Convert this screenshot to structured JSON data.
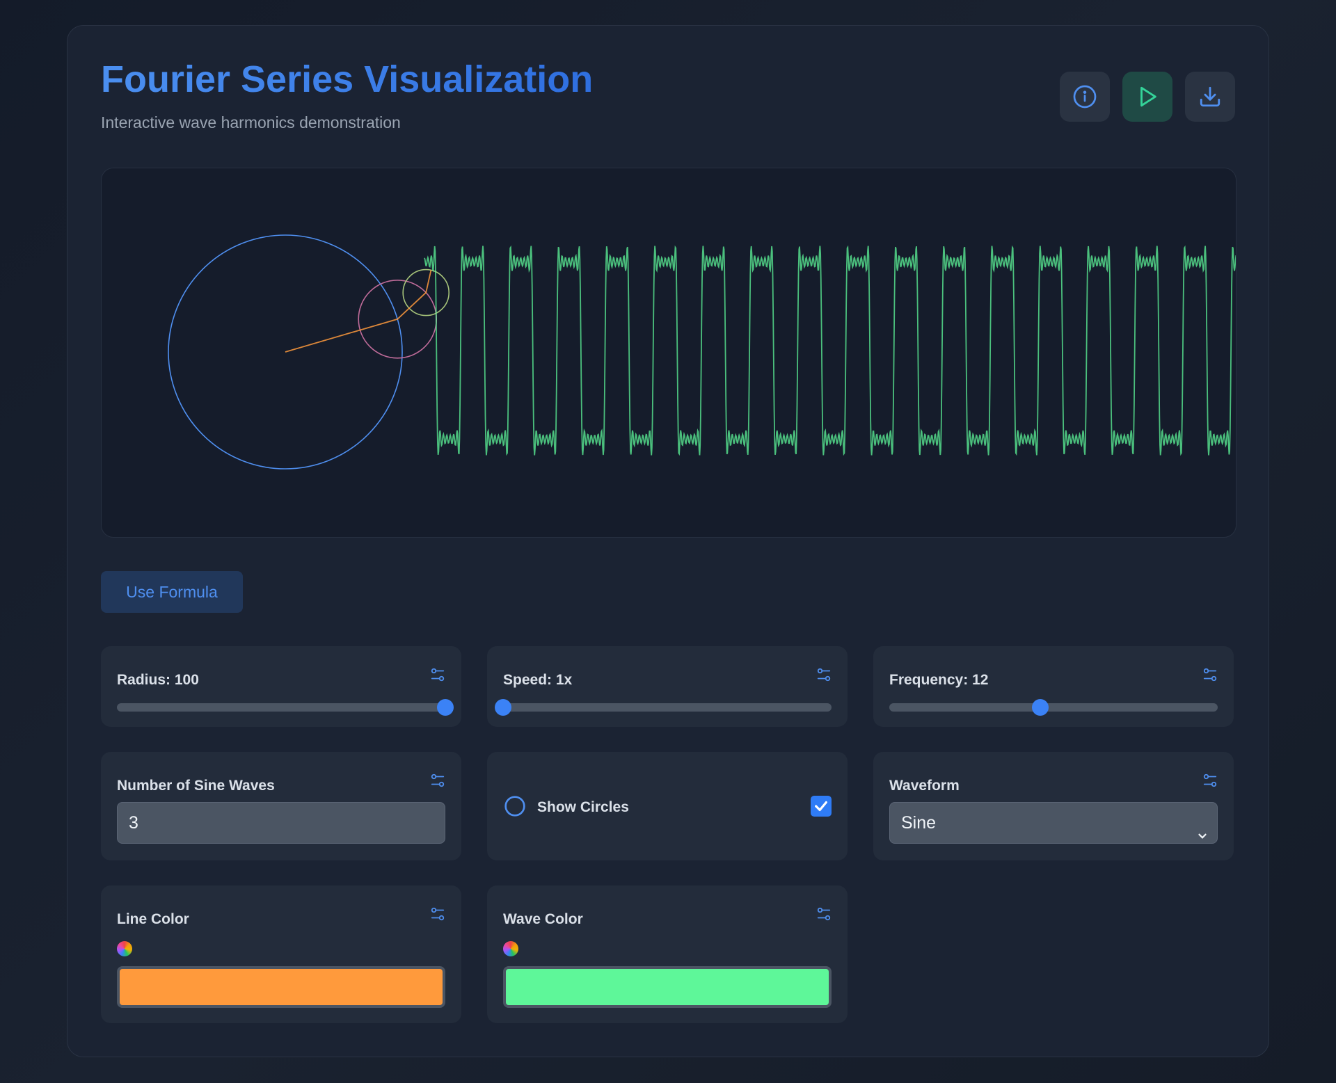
{
  "header": {
    "title": "Fourier Series Visualization",
    "subtitle": "Interactive wave harmonics demonstration"
  },
  "toolbar": {
    "buttons": [
      {
        "icon": "info-icon"
      },
      {
        "icon": "play-icon"
      },
      {
        "icon": "download-icon"
      }
    ]
  },
  "formula_button": "Use Formula",
  "controls": {
    "radius": {
      "label": "Radius: 100",
      "value": 100,
      "fraction": 1.0
    },
    "speed": {
      "label": "Speed: 1x",
      "value": 1,
      "fraction": 0.0
    },
    "frequency": {
      "label": "Frequency: 12",
      "value": 12,
      "fraction": 0.46
    },
    "sine_waves": {
      "label": "Number of Sine Waves",
      "value": "3"
    },
    "show_circles": {
      "label": "Show Circles",
      "checked": true
    },
    "waveform": {
      "label": "Waveform",
      "selected": "Sine"
    },
    "line_color": {
      "label": "Line Color",
      "value": "#ff9a3c"
    },
    "wave_color": {
      "label": "Wave Color",
      "value": "#5ef799"
    }
  },
  "colors": {
    "accent": "#3b82f6",
    "circle_1": "#4f8ff0",
    "circle_2": "#c06c9a",
    "circle_3": "#a7c47a"
  }
}
